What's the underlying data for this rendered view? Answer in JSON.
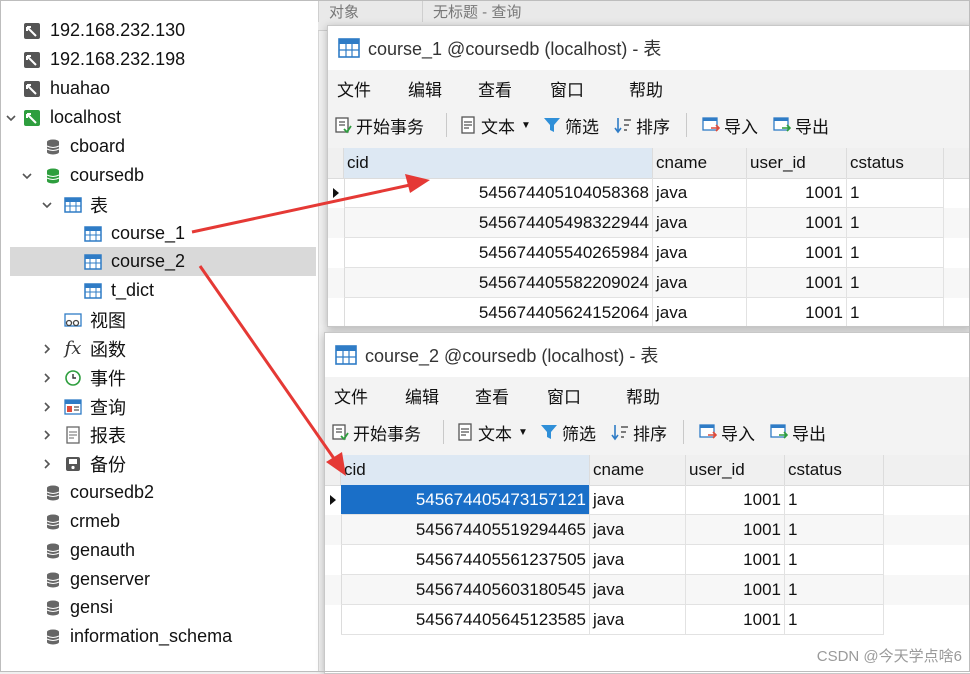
{
  "tree": {
    "items": [
      {
        "label": "192.168.232.130",
        "icon": "connection-icon"
      },
      {
        "label": "192.168.232.198",
        "icon": "connection-icon"
      },
      {
        "label": "huahao",
        "icon": "connection-icon"
      },
      {
        "label": "localhost",
        "icon": "connection-open-icon"
      },
      {
        "label": "cboard",
        "icon": "database-icon"
      },
      {
        "label": "coursedb",
        "icon": "database-open-icon"
      },
      {
        "label": "表",
        "icon": "tables-icon"
      },
      {
        "label": "course_1",
        "icon": "table-icon"
      },
      {
        "label": "course_2",
        "icon": "table-icon"
      },
      {
        "label": "t_dict",
        "icon": "table-icon"
      },
      {
        "label": "视图",
        "icon": "views-icon"
      },
      {
        "label": "函数",
        "icon": "function-icon"
      },
      {
        "label": "事件",
        "icon": "event-icon"
      },
      {
        "label": "查询",
        "icon": "query-icon"
      },
      {
        "label": "报表",
        "icon": "report-icon"
      },
      {
        "label": "备份",
        "icon": "backup-icon"
      },
      {
        "label": "coursedb2",
        "icon": "database-icon"
      },
      {
        "label": "crmeb",
        "icon": "database-icon"
      },
      {
        "label": "genauth",
        "icon": "database-icon"
      },
      {
        "label": "genserver",
        "icon": "database-icon"
      },
      {
        "label": "gensi",
        "icon": "database-icon"
      },
      {
        "label": "information_schema",
        "icon": "database-icon"
      }
    ]
  },
  "background_tabs": [
    "对象",
    "无标题 - 查询"
  ],
  "menu": {
    "file": "文件",
    "edit": "编辑",
    "view": "查看",
    "window": "窗口",
    "help": "帮助"
  },
  "toolbar": {
    "begin_transaction": "开始事务",
    "text": "文本",
    "filter": "筛选",
    "sort": "排序",
    "import": "导入",
    "export": "导出"
  },
  "columns": [
    "cid",
    "cname",
    "user_id",
    "cstatus"
  ],
  "window1": {
    "title": "course_1 @coursedb (localhost) - 表",
    "rows": [
      [
        "545674405104058368",
        "java",
        "1001",
        "1"
      ],
      [
        "545674405498322944",
        "java",
        "1001",
        "1"
      ],
      [
        "545674405540265984",
        "java",
        "1001",
        "1"
      ],
      [
        "545674405582209024",
        "java",
        "1001",
        "1"
      ],
      [
        "545674405624152064",
        "java",
        "1001",
        "1"
      ]
    ]
  },
  "window2": {
    "title": "course_2 @coursedb (localhost) - 表",
    "rows": [
      [
        "545674405473157121",
        "java",
        "1001",
        "1"
      ],
      [
        "545674405519294465",
        "java",
        "1001",
        "1"
      ],
      [
        "545674405561237505",
        "java",
        "1001",
        "1"
      ],
      [
        "545674405603180545",
        "java",
        "1001",
        "1"
      ],
      [
        "545674405645123585",
        "java",
        "1001",
        "1"
      ]
    ]
  },
  "colors": {
    "accent": "#1a6fc8",
    "arrow": "#e53935",
    "selection": "#d9d9d9"
  },
  "watermark": "CSDN @今天学点啥6"
}
